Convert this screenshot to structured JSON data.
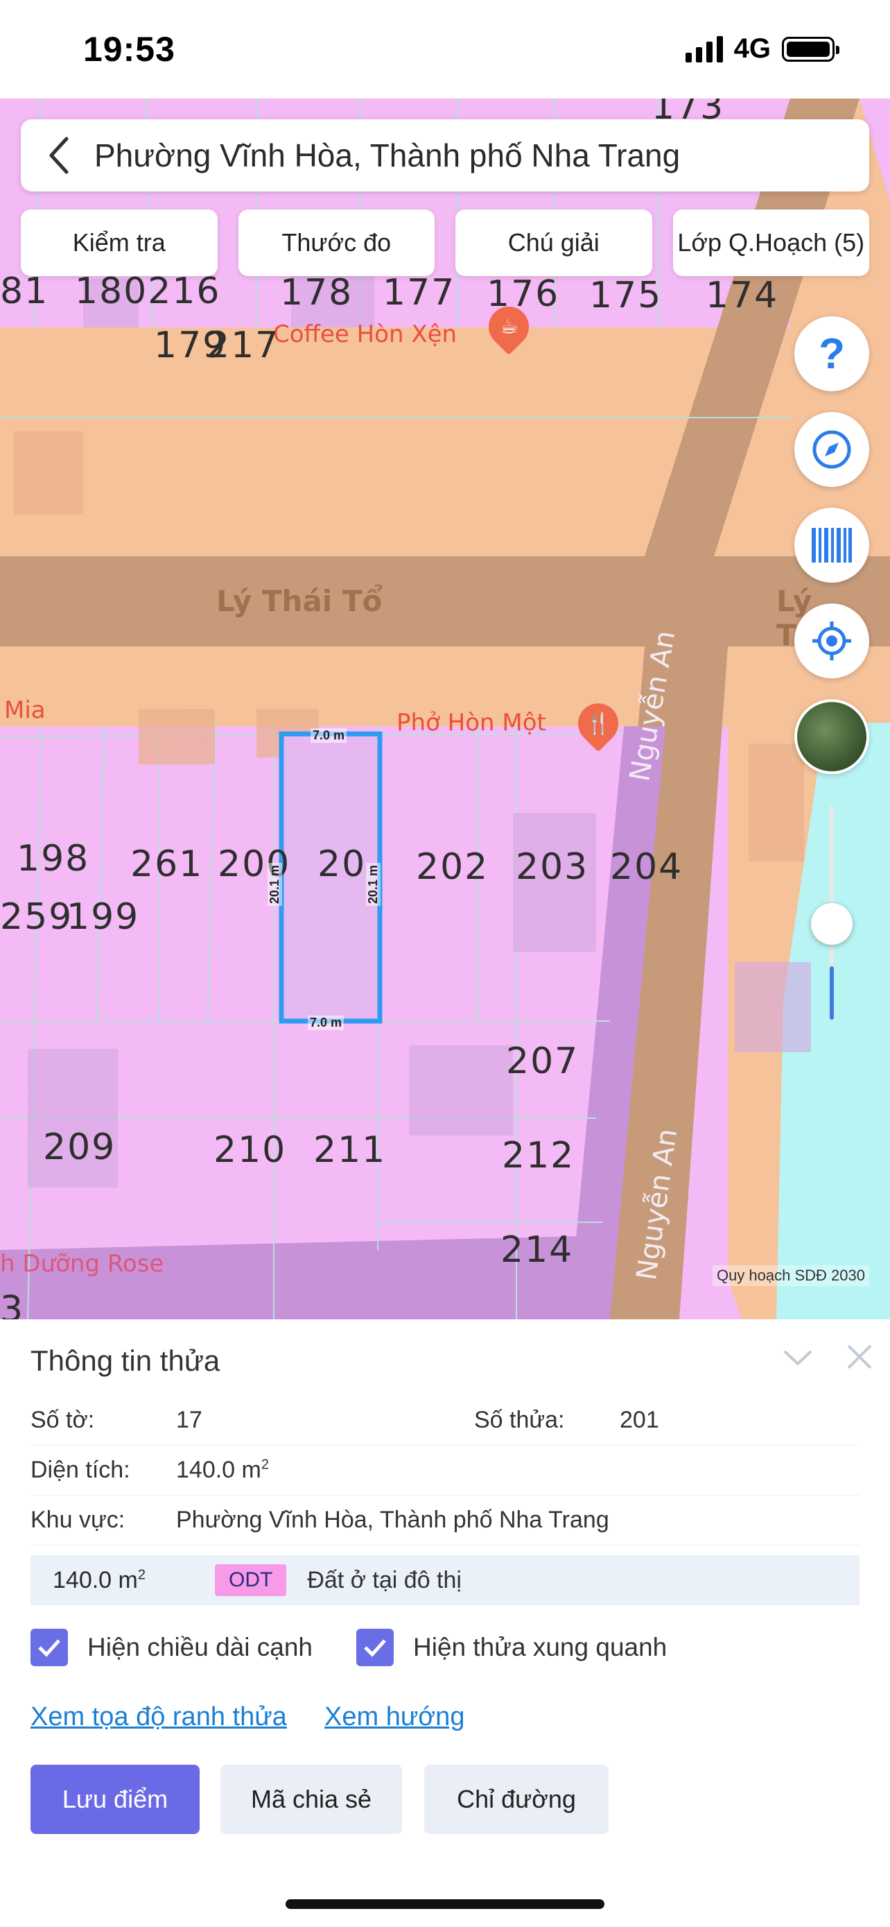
{
  "status_bar": {
    "time": "19:53",
    "network": "4G"
  },
  "search": {
    "title": "Phường Vĩnh Hòa, Thành phố Nha Trang"
  },
  "tools": [
    "Kiểm tra",
    "Thước đo",
    "Chú giải",
    "Lớp Q.Hoạch (5)"
  ],
  "map": {
    "streets": {
      "ly_thai_to": "Lý Thái Tổ",
      "ly_thai_to_right": "Lý Thái",
      "nguyen_an": "Nguyễn An",
      "nguyen_an_2": "Nguyễn An"
    },
    "pois": {
      "coffee": "Coffee Hòn Xện",
      "pho": "Phở Hòn Một",
      "mia": "Mia",
      "rose": "h Dưỡng Rose"
    },
    "parcels": [
      "173",
      "81",
      "180216",
      "178",
      "177",
      "176",
      "175",
      "174",
      "179",
      "217",
      "198",
      "261",
      "200",
      "20",
      "202",
      "203",
      "204",
      "259",
      "199",
      "207",
      "209",
      "210",
      "211",
      "212",
      "214",
      "3"
    ],
    "dims": {
      "top": "7.0 m",
      "bottom": "7.0 m",
      "left": "20.1 m",
      "right": "20.1 m"
    },
    "credit": "Quy hoạch SDĐ 2030",
    "selected_parcel_color": "#3aa0f0",
    "zoom_level": 0.25
  },
  "panel": {
    "title": "Thông tin thửa",
    "so_to_label": "Số tờ:",
    "so_to_value": "17",
    "so_thua_label": "Số thửa:",
    "so_thua_value": "201",
    "dien_tich_label": "Diện tích:",
    "dien_tich_value": "140.0 m",
    "khu_vuc_label": "Khu vực:",
    "khu_vuc_value": "Phường Vĩnh Hòa, Thành phố Nha Trang",
    "land_area": "140.0 m",
    "land_code": "ODT",
    "land_desc": "Đất ở tại đô thị",
    "check1": "Hiện chiều dài cạnh",
    "check2": "Hiện thửa xung quanh",
    "link1": "Xem tọa độ ranh thửa",
    "link2": "Xem hướng",
    "btn_save": "Lưu điểm",
    "btn_share": "Mã chia sẻ",
    "btn_route": "Chỉ đường",
    "unit_exp": "2"
  }
}
